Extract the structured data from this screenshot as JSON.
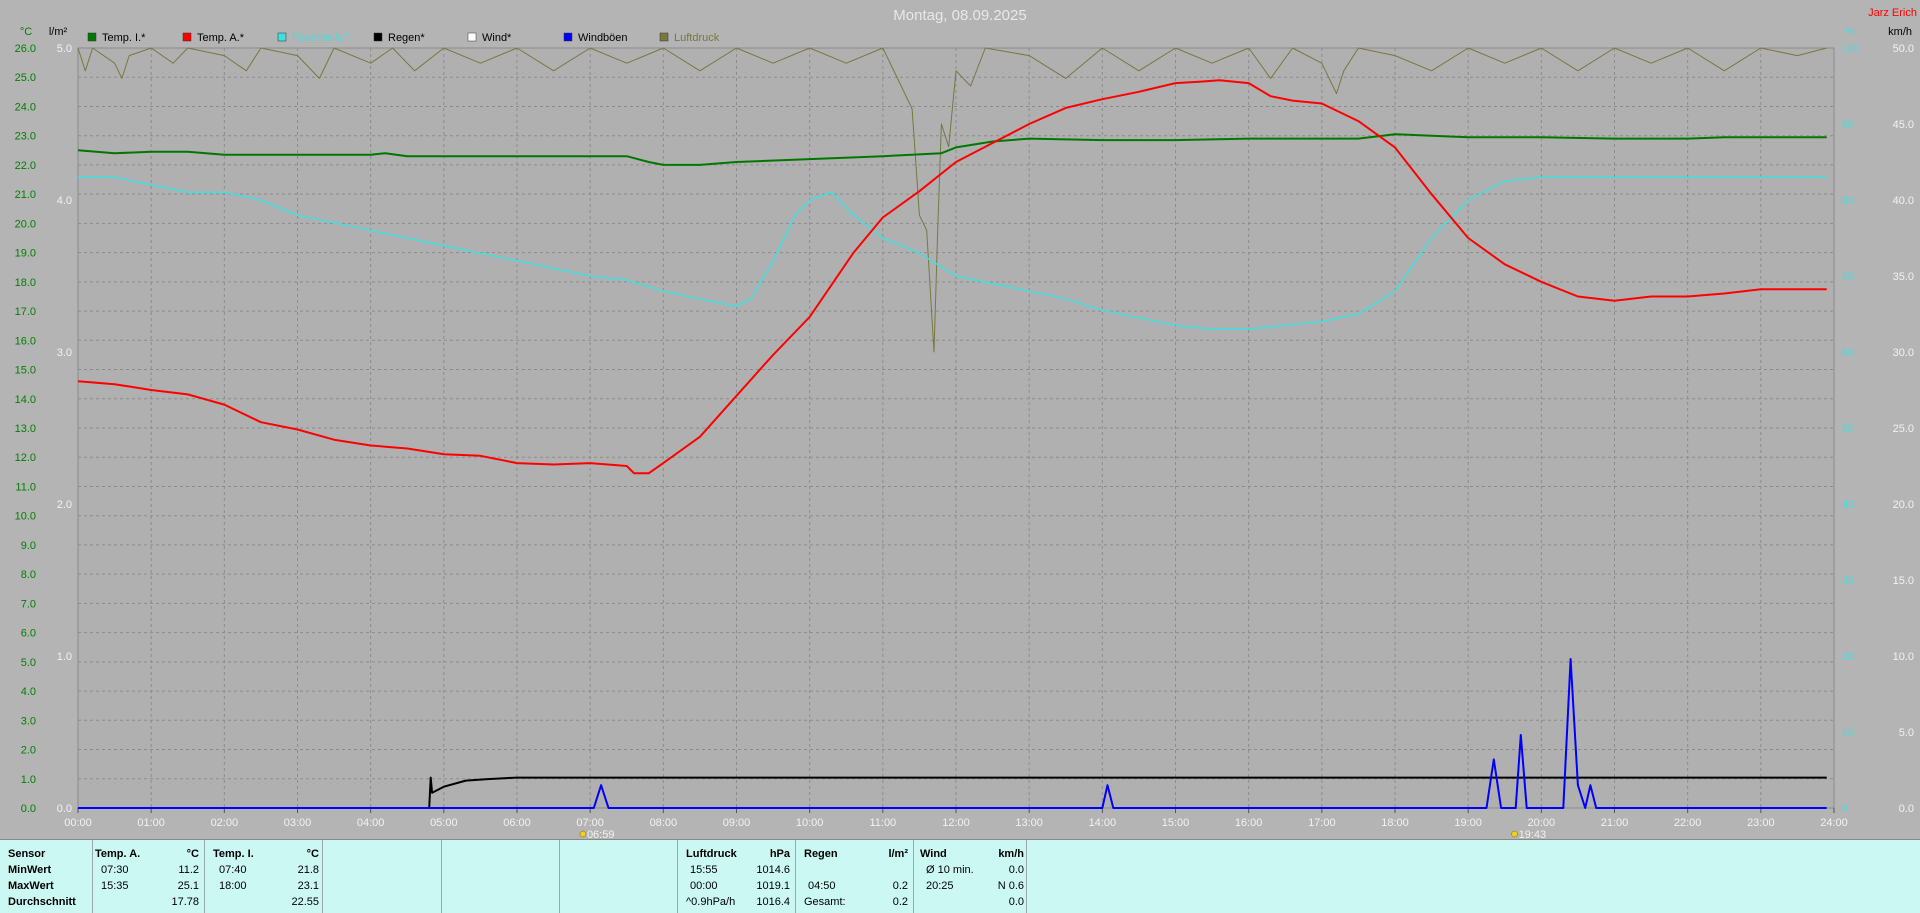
{
  "header": {
    "title": "Montag, 08.09.2025",
    "author": "Jarz Erich",
    "sun_marks": [
      "06:59",
      "19:43"
    ]
  },
  "colors": {
    "temp_inside": "#007800",
    "temp_outside": "#ff0000",
    "humidity": "#40e0e0",
    "rain": "#000000",
    "wind": "#ffffff",
    "gusts": "#0000ff",
    "pressure": "#787840",
    "axis_temp": "#008000",
    "axis_right": "#40e0e0",
    "footer_bg": "#ccf8f4"
  },
  "chart_data": {
    "type": "line",
    "title": "Montag, 08.09.2025",
    "legend": [
      "Temp. I.*",
      "Temp. A.*",
      "Feuchte A.*",
      "Regen*",
      "Wind*",
      "Windböen",
      "Luftdruck"
    ],
    "axes": {
      "left_temp": {
        "label": "°C",
        "ticks": [
          "0.0",
          "1.0",
          "2.0",
          "3.0",
          "4.0",
          "5.0",
          "6.0",
          "7.0",
          "8.0",
          "9.0",
          "10.0",
          "11.0",
          "12.0",
          "13.0",
          "14.0",
          "15.0",
          "16.0",
          "17.0",
          "18.0",
          "19.0",
          "20.0",
          "21.0",
          "22.0",
          "23.0",
          "24.0",
          "25.0",
          "26.0"
        ],
        "range": [
          0,
          26
        ]
      },
      "left_rain": {
        "label": "l/m²",
        "ticks": [
          "0.0",
          "1.0",
          "2.0",
          "3.0",
          "4.0",
          "5.0"
        ],
        "range": [
          0,
          5
        ]
      },
      "right_humidity": {
        "label": "%",
        "ticks": [
          "0",
          "10",
          "20",
          "30",
          "40",
          "50",
          "60",
          "70",
          "80",
          "90",
          "100"
        ],
        "range": [
          0,
          100
        ]
      },
      "right_wind": {
        "label": "km/h",
        "ticks": [
          "0.0",
          "5.0",
          "10.0",
          "15.0",
          "20.0",
          "25.0",
          "30.0",
          "35.0",
          "40.0",
          "45.0",
          "50.0"
        ],
        "range": [
          0,
          50
        ]
      },
      "x": {
        "ticks": [
          "00:00",
          "01:00",
          "02:00",
          "03:00",
          "04:00",
          "05:00",
          "06:00",
          "07:00",
          "08:00",
          "09:00",
          "10:00",
          "11:00",
          "12:00",
          "13:00",
          "14:00",
          "15:00",
          "16:00",
          "17:00",
          "18:00",
          "19:00",
          "20:00",
          "21:00",
          "22:00",
          "23:00",
          "24:00"
        ],
        "range_hours": [
          0,
          24
        ]
      }
    },
    "grid": true,
    "series": [
      {
        "name": "Temp. I.*",
        "axis": "left_temp",
        "x_unit": "hour",
        "points": [
          [
            0,
            22.5
          ],
          [
            0.5,
            22.4
          ],
          [
            1,
            22.45
          ],
          [
            1.5,
            22.45
          ],
          [
            2,
            22.35
          ],
          [
            3,
            22.35
          ],
          [
            4,
            22.35
          ],
          [
            4.2,
            22.4
          ],
          [
            4.5,
            22.3
          ],
          [
            5,
            22.3
          ],
          [
            6,
            22.3
          ],
          [
            7,
            22.3
          ],
          [
            7.5,
            22.3
          ],
          [
            7.8,
            22.1
          ],
          [
            8,
            22.0
          ],
          [
            8.5,
            22.0
          ],
          [
            9,
            22.1
          ],
          [
            10,
            22.2
          ],
          [
            11,
            22.3
          ],
          [
            11.8,
            22.4
          ],
          [
            12,
            22.6
          ],
          [
            12.5,
            22.8
          ],
          [
            13,
            22.9
          ],
          [
            14,
            22.85
          ],
          [
            15,
            22.85
          ],
          [
            16,
            22.9
          ],
          [
            17,
            22.9
          ],
          [
            17.5,
            22.9
          ],
          [
            18,
            23.05
          ],
          [
            18.5,
            23.0
          ],
          [
            19,
            22.95
          ],
          [
            20,
            22.95
          ],
          [
            21,
            22.9
          ],
          [
            22,
            22.9
          ],
          [
            22.5,
            22.95
          ],
          [
            23.9,
            22.95
          ]
        ]
      },
      {
        "name": "Temp. A.*",
        "axis": "left_temp",
        "x_unit": "hour",
        "points": [
          [
            0,
            14.6
          ],
          [
            0.5,
            14.5
          ],
          [
            1,
            14.3
          ],
          [
            1.5,
            14.15
          ],
          [
            2,
            13.8
          ],
          [
            2.5,
            13.2
          ],
          [
            3,
            12.95
          ],
          [
            3.5,
            12.6
          ],
          [
            4,
            12.4
          ],
          [
            4.5,
            12.3
          ],
          [
            5,
            12.1
          ],
          [
            5.5,
            12.05
          ],
          [
            6,
            11.8
          ],
          [
            6.5,
            11.75
          ],
          [
            7,
            11.8
          ],
          [
            7.5,
            11.7
          ],
          [
            7.6,
            11.45
          ],
          [
            7.8,
            11.45
          ],
          [
            8,
            11.8
          ],
          [
            8.5,
            12.7
          ],
          [
            9,
            14.1
          ],
          [
            9.5,
            15.5
          ],
          [
            10,
            16.8
          ],
          [
            10.3,
            17.9
          ],
          [
            10.6,
            19.0
          ],
          [
            11,
            20.2
          ],
          [
            11.5,
            21.1
          ],
          [
            12,
            22.1
          ],
          [
            12.5,
            22.75
          ],
          [
            13,
            23.4
          ],
          [
            13.5,
            23.95
          ],
          [
            14,
            24.25
          ],
          [
            14.5,
            24.5
          ],
          [
            15,
            24.8
          ],
          [
            15.35,
            24.85
          ],
          [
            15.6,
            24.9
          ],
          [
            16,
            24.8
          ],
          [
            16.3,
            24.35
          ],
          [
            16.6,
            24.2
          ],
          [
            17,
            24.1
          ],
          [
            17.5,
            23.5
          ],
          [
            18,
            22.6
          ],
          [
            18.5,
            21.0
          ],
          [
            19,
            19.5
          ],
          [
            19.5,
            18.6
          ],
          [
            20,
            18.0
          ],
          [
            20.5,
            17.5
          ],
          [
            21,
            17.35
          ],
          [
            21.5,
            17.5
          ],
          [
            22,
            17.5
          ],
          [
            22.5,
            17.6
          ],
          [
            23,
            17.75
          ],
          [
            23.9,
            17.75
          ]
        ]
      },
      {
        "name": "Feuchte A.*",
        "axis": "right_humidity",
        "x_unit": "hour",
        "points": [
          [
            0,
            83
          ],
          [
            0.5,
            83
          ],
          [
            1,
            82
          ],
          [
            1.5,
            81
          ],
          [
            2,
            81
          ],
          [
            2.5,
            80
          ],
          [
            3,
            78
          ],
          [
            3.5,
            77
          ],
          [
            4,
            76
          ],
          [
            4.5,
            75
          ],
          [
            5,
            74
          ],
          [
            5.5,
            73
          ],
          [
            6,
            72
          ],
          [
            6.5,
            71
          ],
          [
            7,
            70
          ],
          [
            7.5,
            69.5
          ],
          [
            8,
            68
          ],
          [
            8.5,
            67
          ],
          [
            9,
            66
          ],
          [
            9.2,
            67
          ],
          [
            9.5,
            72
          ],
          [
            9.8,
            78
          ],
          [
            10,
            80
          ],
          [
            10.3,
            81
          ],
          [
            10.6,
            78
          ],
          [
            11,
            75
          ],
          [
            11.5,
            73
          ],
          [
            12,
            70
          ],
          [
            12.5,
            69
          ],
          [
            13,
            68
          ],
          [
            13.5,
            67
          ],
          [
            14,
            65.5
          ],
          [
            14.5,
            64.5
          ],
          [
            15,
            63.5
          ],
          [
            15.5,
            63
          ],
          [
            16,
            63
          ],
          [
            16.5,
            63.5
          ],
          [
            17,
            64
          ],
          [
            17.5,
            65
          ],
          [
            18,
            68
          ],
          [
            18.5,
            75
          ],
          [
            19,
            80
          ],
          [
            19.5,
            82.5
          ],
          [
            20,
            83
          ],
          [
            21,
            83
          ],
          [
            22,
            83
          ],
          [
            23,
            83
          ],
          [
            23.9,
            83
          ]
        ]
      },
      {
        "name": "Regen*",
        "axis": "left_rain",
        "x_unit": "hour",
        "points": [
          [
            0,
            0
          ],
          [
            4.8,
            0
          ],
          [
            4.82,
            0.2
          ],
          [
            4.84,
            0.1
          ],
          [
            5,
            0.14
          ],
          [
            5.3,
            0.18
          ],
          [
            5.6,
            0.19
          ],
          [
            6,
            0.2
          ],
          [
            12,
            0.2
          ],
          [
            18,
            0.2
          ],
          [
            23.9,
            0.2
          ]
        ]
      },
      {
        "name": "Windböen",
        "axis": "right_wind",
        "x_unit": "hour",
        "points": [
          [
            0,
            0
          ],
          [
            7.05,
            0
          ],
          [
            7.15,
            1.5
          ],
          [
            7.25,
            0
          ],
          [
            14,
            0
          ],
          [
            14.07,
            1.5
          ],
          [
            14.15,
            0
          ],
          [
            19.25,
            0
          ],
          [
            19.35,
            3.2
          ],
          [
            19.45,
            0
          ],
          [
            19.65,
            0
          ],
          [
            19.72,
            4.8
          ],
          [
            19.8,
            0
          ],
          [
            20.3,
            0
          ],
          [
            20.4,
            9.8
          ],
          [
            20.5,
            1.5
          ],
          [
            20.6,
            0
          ],
          [
            20.67,
            1.5
          ],
          [
            20.75,
            0
          ],
          [
            23.9,
            0
          ]
        ]
      },
      {
        "name": "Luftdruck",
        "axis": "right_humidity",
        "x_unit": "hour",
        "points": [
          [
            0,
            100
          ],
          [
            0.1,
            97
          ],
          [
            0.2,
            100
          ],
          [
            0.5,
            98
          ],
          [
            0.6,
            96
          ],
          [
            0.7,
            99
          ],
          [
            1,
            100
          ],
          [
            1.3,
            98
          ],
          [
            1.5,
            100
          ],
          [
            2,
            99
          ],
          [
            2.3,
            97
          ],
          [
            2.5,
            100
          ],
          [
            3,
            99
          ],
          [
            3.3,
            96
          ],
          [
            3.5,
            100
          ],
          [
            4,
            98
          ],
          [
            4.3,
            100
          ],
          [
            4.6,
            97
          ],
          [
            5,
            100
          ],
          [
            5.5,
            98
          ],
          [
            6,
            100
          ],
          [
            6.5,
            97
          ],
          [
            7,
            100
          ],
          [
            7.5,
            98
          ],
          [
            8,
            100
          ],
          [
            8.5,
            97
          ],
          [
            9,
            100
          ],
          [
            9.5,
            98
          ],
          [
            10,
            100
          ],
          [
            10.5,
            98
          ],
          [
            11,
            100
          ],
          [
            11.2,
            96
          ],
          [
            11.4,
            92
          ],
          [
            11.5,
            78
          ],
          [
            11.6,
            76
          ],
          [
            11.7,
            60
          ],
          [
            11.75,
            76
          ],
          [
            11.8,
            90
          ],
          [
            11.9,
            87
          ],
          [
            12,
            97
          ],
          [
            12.2,
            95
          ],
          [
            12.4,
            100
          ],
          [
            13,
            99
          ],
          [
            13.5,
            96
          ],
          [
            14,
            100
          ],
          [
            14.5,
            97
          ],
          [
            15,
            100
          ],
          [
            15.5,
            98
          ],
          [
            16,
            100
          ],
          [
            16.3,
            96
          ],
          [
            16.6,
            100
          ],
          [
            17,
            98
          ],
          [
            17.2,
            94
          ],
          [
            17.3,
            97
          ],
          [
            17.5,
            100
          ],
          [
            18,
            99
          ],
          [
            18.5,
            97
          ],
          [
            19,
            100
          ],
          [
            19.5,
            98
          ],
          [
            20,
            100
          ],
          [
            20.5,
            97
          ],
          [
            21,
            100
          ],
          [
            21.5,
            98
          ],
          [
            22,
            100
          ],
          [
            22.5,
            97
          ],
          [
            23,
            100
          ],
          [
            23.5,
            99
          ],
          [
            23.9,
            100
          ]
        ]
      }
    ]
  },
  "footer": {
    "sensor": {
      "title": "Sensor",
      "rows": [
        "MinWert",
        "MaxWert",
        "Durchschnitt"
      ]
    },
    "temp_a": {
      "title": "Temp. A.",
      "unit": "°C",
      "rows": [
        [
          "07:30",
          "11.2"
        ],
        [
          "15:35",
          "25.1"
        ],
        [
          "",
          "17.78"
        ]
      ]
    },
    "temp_i": {
      "title": "Temp. I.",
      "unit": "°C",
      "rows": [
        [
          "07:40",
          "21.8"
        ],
        [
          "18:00",
          "23.1"
        ],
        [
          "",
          "22.55"
        ]
      ]
    },
    "pressure": {
      "title": "Luftdruck",
      "unit": "hPa",
      "rows": [
        [
          "15:55",
          "1014.6"
        ],
        [
          "00:00",
          "1019.1"
        ],
        [
          "^0.9hPa/h",
          "1016.4"
        ]
      ]
    },
    "rain": {
      "title": "Regen",
      "unit": "l/m²",
      "rows": [
        [
          "",
          ""
        ],
        [
          "04:50",
          "0.2"
        ],
        [
          "Gesamt:",
          "0.2"
        ]
      ]
    },
    "wind": {
      "title": "Wind",
      "unit": "km/h",
      "rows": [
        [
          "Ø 10 min.",
          "0.0"
        ],
        [
          "20:25",
          "N 0.6"
        ],
        [
          "",
          "0.0"
        ]
      ]
    }
  }
}
